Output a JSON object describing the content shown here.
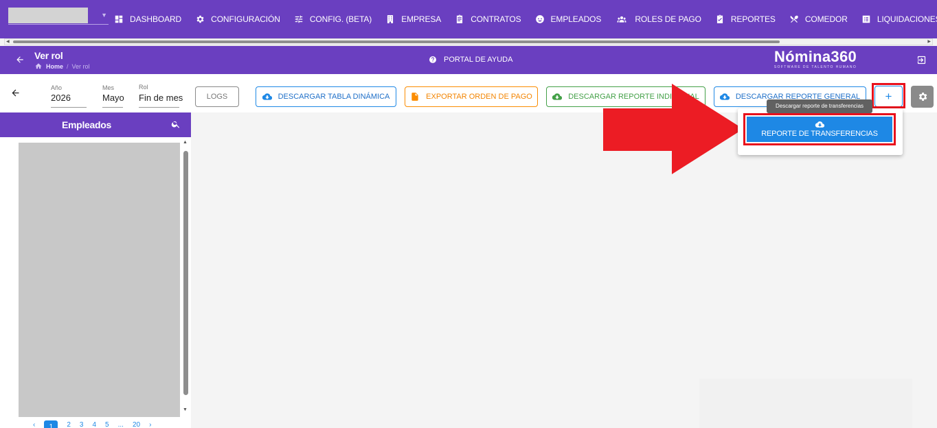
{
  "topnav": {
    "items": [
      {
        "label": "DASHBOARD",
        "icon": "dashboard-icon"
      },
      {
        "label": "CONFIGURACIÓN",
        "icon": "gear-icon"
      },
      {
        "label": "CONFIG. (BETA)",
        "icon": "sliders-icon"
      },
      {
        "label": "EMPRESA",
        "icon": "building-icon"
      },
      {
        "label": "CONTRATOS",
        "icon": "clipboard-icon"
      },
      {
        "label": "EMPLEADOS",
        "icon": "face-icon"
      },
      {
        "label": "ROLES DE PAGO",
        "icon": "people-icon"
      },
      {
        "label": "REPORTES",
        "icon": "report-icon"
      },
      {
        "label": "COMEDOR",
        "icon": "utensils-icon"
      },
      {
        "label": "LIQUIDACIONES",
        "icon": "list-icon"
      }
    ]
  },
  "titlebar": {
    "title": "Ver rol",
    "breadcrumb_home": "Home",
    "breadcrumb_sep": "/",
    "breadcrumb_current": "Ver rol",
    "help_label": "PORTAL DE AYUDA",
    "brand_name": "Nómina360",
    "brand_tagline": "SOFTWARE DE TALENTO HUMANO"
  },
  "toolbar": {
    "year_label": "Año",
    "year_value": "2026",
    "month_label": "Mes",
    "month_value": "Mayo",
    "rol_label": "Rol",
    "rol_value": "Fin de mes",
    "logs_label": "LOGS",
    "pivot_label": "DESCARGAR TABLA DINÁMICA",
    "order_label": "EXPORTAR ORDEN DE PAGO",
    "individual_label": "DESCARGAR REPORTE INDIVIDUAL",
    "general_label": "DESCARGAR REPORTE GENERAL",
    "plus_label": "+"
  },
  "sidebar": {
    "title": "Empleados",
    "pages": [
      "1",
      "2",
      "3",
      "4",
      "5",
      "...",
      "20"
    ]
  },
  "menu": {
    "tooltip": "Descargar reporte de transferencias",
    "transfer_label": "REPORTE DE TRANSFERENCIAS"
  },
  "colors": {
    "brand_purple": "#6a3fc0",
    "primary_blue": "#1e88e5",
    "orange": "#fb8c00",
    "green": "#43a047",
    "highlight_red": "#e8101c"
  }
}
